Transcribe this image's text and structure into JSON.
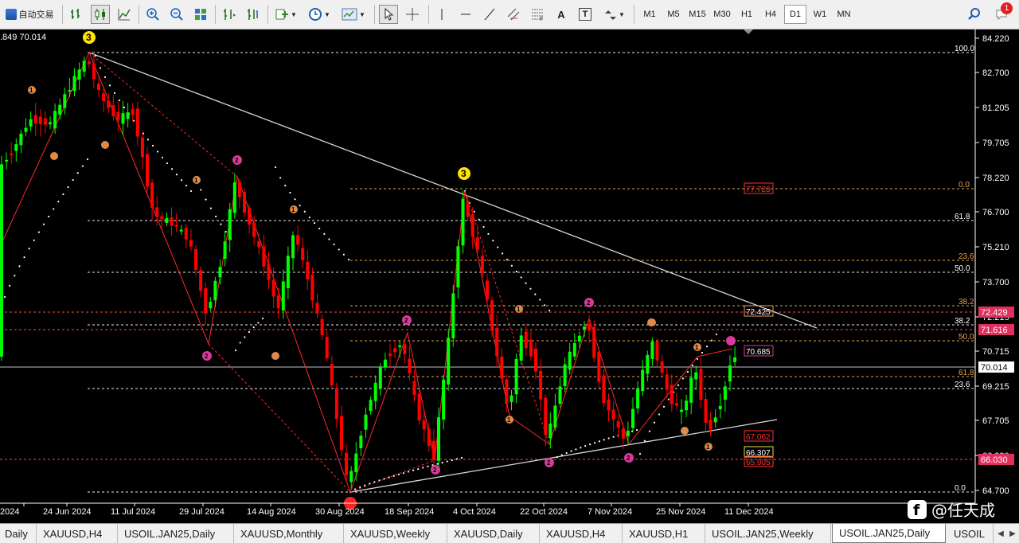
{
  "toolbar": {
    "auto_trading_label": "自动交易",
    "timeframes": [
      "M1",
      "M5",
      "M15",
      "M30",
      "H1",
      "H4",
      "D1",
      "W1",
      "MN"
    ],
    "active_timeframe": "D1",
    "text_tool_label": "A",
    "label_tool_label": "T",
    "alert_badge": "1"
  },
  "chart": {
    "ohlc_readout": ".849 70.014",
    "current_price": "70.014",
    "colors": {
      "bull": "#00ff00",
      "bear": "#ff0000",
      "fib": "#e9a24b",
      "grid": "#ffffff",
      "axis": "#ffffff"
    },
    "price_scale": [
      "84.220",
      "82.700",
      "81.205",
      "79.705",
      "78.220",
      "76.700",
      "75.210",
      "73.700",
      "72.215",
      "70.715",
      "69.215",
      "67.705",
      "66.220",
      "64.700"
    ],
    "date_scale": [
      "2024",
      "24 Jun 2024",
      "11 Jul 2024",
      "29 Jul 2024",
      "14 Aug 2024",
      "30 Aug 2024",
      "18 Sep 2024",
      "4 Oct 2024",
      "22 Oct 2024",
      "7 Nov 2024",
      "25 Nov 2024",
      "11 Dec 2024"
    ],
    "fib_labels_a": [
      "100.0",
      "61.8",
      "50.0",
      "38.2",
      "23.6",
      "0.0"
    ],
    "fib_labels_b": [
      "0.0",
      "23.6",
      "38.2",
      "50.0",
      "61.8",
      "100.0"
    ],
    "price_tags": [
      "72.429",
      "71.616",
      "66.030"
    ],
    "annotation_boxes": [
      "77.723",
      "72.425",
      "70.685",
      "67.062",
      "66.307",
      "65.905"
    ],
    "wave_labels": [
      "3",
      "1",
      "2",
      "3",
      "1",
      "2",
      "1",
      "2",
      "1",
      "2",
      "1",
      "2",
      "1",
      "2",
      "1",
      "2",
      "1"
    ],
    "watermark": "@任天成"
  },
  "tabs": [
    "Daily",
    "XAUUSD,H4",
    "USOIL.JAN25,Daily",
    "XAUUSD,Monthly",
    "XAUUSD,Weekly",
    "XAUUSD,Daily",
    "XAUUSD,H4",
    "XAUUSD,H1",
    "USOIL.JAN25,Weekly",
    "USOIL.JAN25,Daily",
    "USOIL"
  ],
  "active_tab": "USOIL.JAN25,Daily"
}
